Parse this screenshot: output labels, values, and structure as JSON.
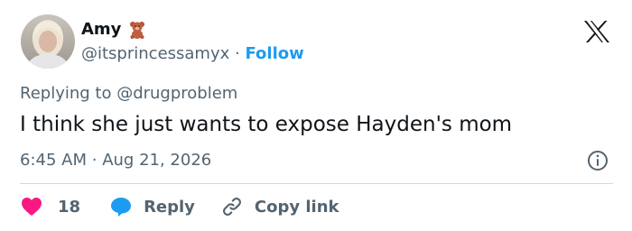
{
  "author": {
    "name": "Amy",
    "handle": "@itsprincessamyx",
    "separator": "·",
    "follow_label": "Follow",
    "name_emoji_icon": "teddy-bear-icon"
  },
  "brand": {
    "logo_icon": "x-logo-icon"
  },
  "tweet": {
    "replying_to": "Replying to @drugproblem",
    "text": "I think she just wants to expose Hayden's mom",
    "time": "6:45 AM",
    "separator": "·",
    "date": "Aug 21, 2026"
  },
  "actions": {
    "like_count": "18",
    "reply_label": "Reply",
    "copy_link_label": "Copy link"
  },
  "colors": {
    "text_primary": "#0f1419",
    "text_secondary": "#536471",
    "accent": "#1d9bf0",
    "like": "#f91880",
    "divider": "#cfd9de"
  }
}
